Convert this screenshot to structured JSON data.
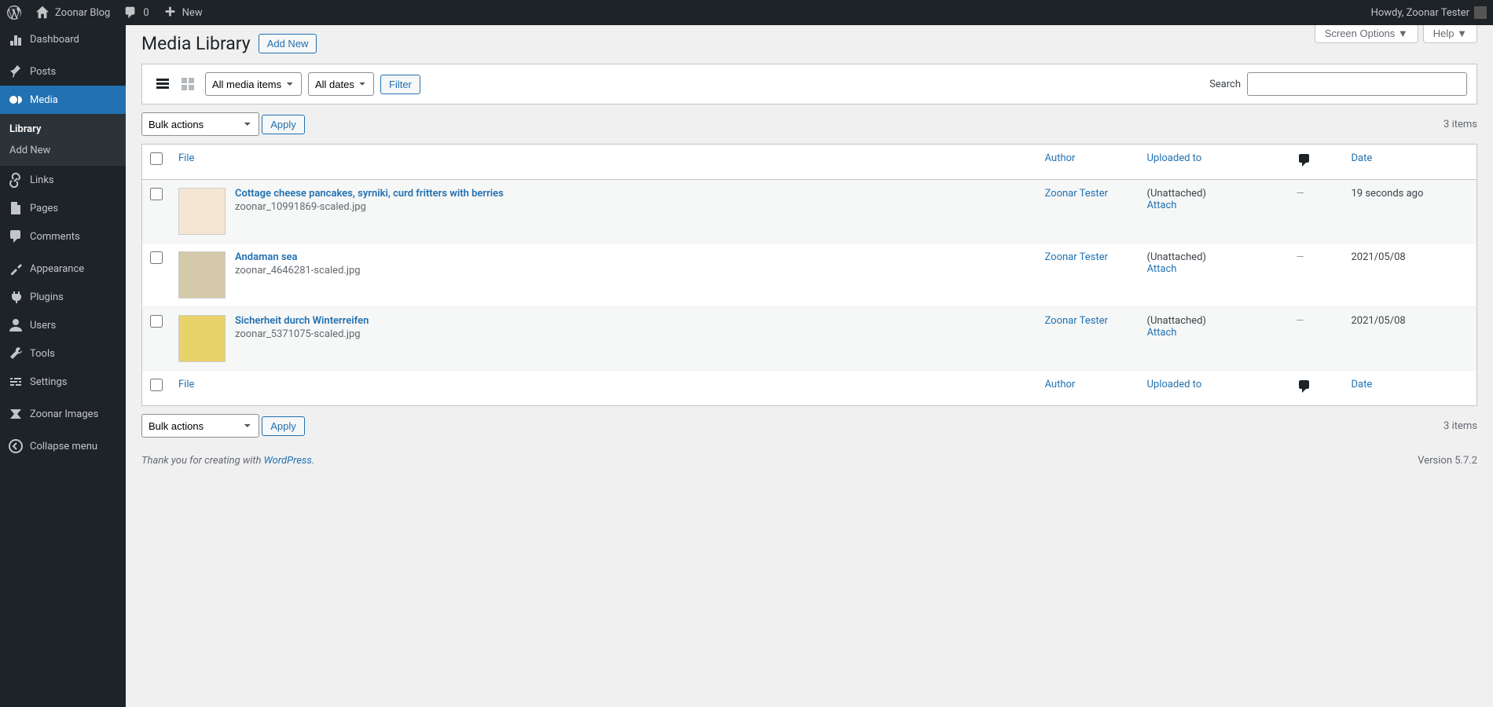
{
  "adminbar": {
    "site_name": "Zoonar Blog",
    "comments": "0",
    "new": "New",
    "howdy": "Howdy, Zoonar Tester"
  },
  "sidebar": {
    "dashboard": "Dashboard",
    "posts": "Posts",
    "media": "Media",
    "media_sub": {
      "library": "Library",
      "add_new": "Add New"
    },
    "links": "Links",
    "pages": "Pages",
    "comments": "Comments",
    "appearance": "Appearance",
    "plugins": "Plugins",
    "users": "Users",
    "tools": "Tools",
    "settings": "Settings",
    "zoonar": "Zoonar Images",
    "collapse": "Collapse menu"
  },
  "screen_meta": {
    "options": "Screen Options ▼",
    "help": "Help ▼"
  },
  "page": {
    "title": "Media Library",
    "add_new": "Add New"
  },
  "filter": {
    "media_items": "All media items",
    "dates": "All dates",
    "filter_btn": "Filter",
    "search_label": "Search"
  },
  "bulk": {
    "label": "Bulk actions",
    "apply": "Apply"
  },
  "count": "3 items",
  "columns": {
    "file": "File",
    "author": "Author",
    "parent": "Uploaded to",
    "date": "Date"
  },
  "rows": [
    {
      "title": "Cottage cheese pancakes, syrniki, curd fritters with berries",
      "filename": "zoonar_10991869-scaled.jpg",
      "author": "Zoonar Tester",
      "parent": "(Unattached)",
      "attach": "Attach",
      "comments": "—",
      "date": "19 seconds ago"
    },
    {
      "title": "Andaman sea",
      "filename": "zoonar_4646281-scaled.jpg",
      "author": "Zoonar Tester",
      "parent": "(Unattached)",
      "attach": "Attach",
      "comments": "—",
      "date": "2021/05/08"
    },
    {
      "title": "Sicherheit durch Winterreifen",
      "filename": "zoonar_5371075-scaled.jpg",
      "author": "Zoonar Tester",
      "parent": "(Unattached)",
      "attach": "Attach",
      "comments": "—",
      "date": "2021/05/08"
    }
  ],
  "footer": {
    "thank": "Thank you for creating with ",
    "wp": "WordPress",
    "dot": ".",
    "version": "Version 5.7.2"
  }
}
